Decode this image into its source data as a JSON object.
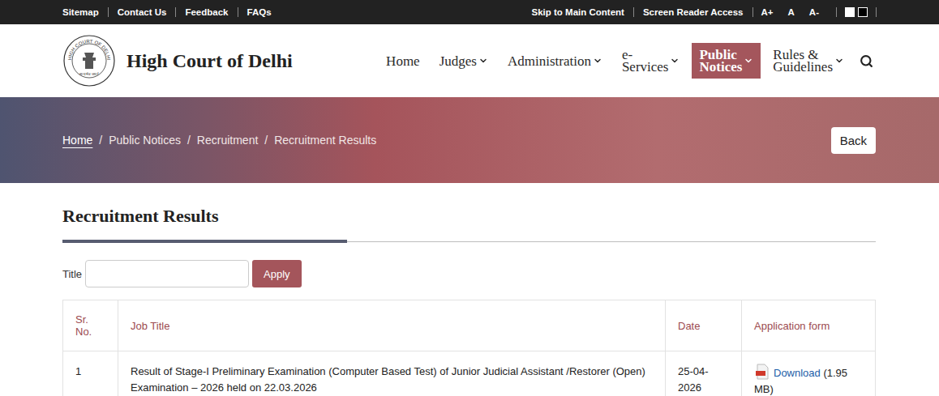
{
  "topbar": {
    "links": [
      "Sitemap",
      "Contact Us",
      "Feedback",
      "FAQs"
    ],
    "rightLinks": [
      "Skip to Main Content",
      "Screen Reader Access"
    ],
    "fontSizes": [
      "A+",
      "A",
      "A-"
    ],
    "contrast": [
      {
        "color": "#ffffff"
      },
      {
        "color": "#000000"
      }
    ]
  },
  "header": {
    "title": "High Court of Delhi",
    "logoText": "HIGH COURT OF DELHI",
    "logoMotto": "सत्यमेव जयते"
  },
  "nav": [
    {
      "label": "Home",
      "dropdown": false,
      "selected": false
    },
    {
      "label": "Judges",
      "dropdown": true,
      "selected": false
    },
    {
      "label": "Administration",
      "dropdown": true,
      "selected": false
    },
    {
      "label": "e-Services",
      "dropdown": true,
      "selected": false
    },
    {
      "label": "Public Notices",
      "dropdown": true,
      "selected": true
    },
    {
      "label": "Rules & Guidelines",
      "dropdown": true,
      "selected": false
    }
  ],
  "breadcrumb": {
    "separator": "/",
    "items": [
      {
        "label": "Home",
        "link": true
      },
      {
        "label": "Public Notices",
        "link": false
      },
      {
        "label": "Recruitment",
        "link": false
      },
      {
        "label": "Recruitment Results",
        "link": false
      }
    ]
  },
  "backButton": "Back",
  "page": {
    "title": "Recruitment Results"
  },
  "filter": {
    "label": "Title",
    "value": "",
    "button": "Apply"
  },
  "table": {
    "columns": [
      "Sr. No.",
      "Job Title",
      "Date",
      "Application form"
    ],
    "rows": [
      {
        "sr": "1",
        "title": "Result of Stage-I Preliminary Examination (Computer Based Test) of Junior Judicial Assistant /Restorer (Open) Examination – 2026 held on 22.03.2026",
        "date": "25-04-2026",
        "link": "Download",
        "size": "(1.95 MB)"
      }
    ]
  }
}
